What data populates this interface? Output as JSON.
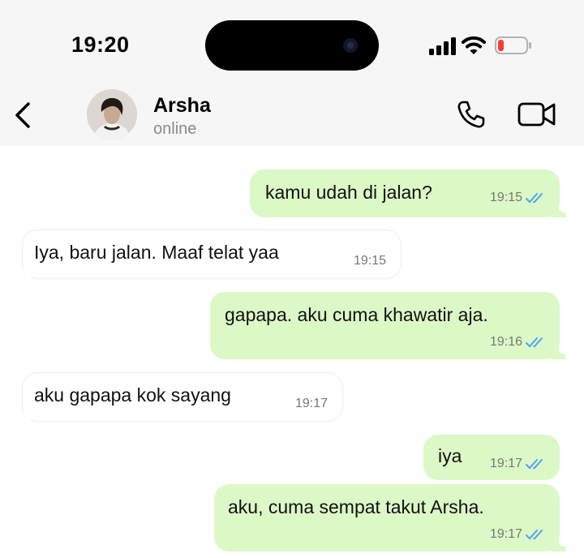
{
  "status_bar": {
    "time": "19:20",
    "icons": [
      "signal-icon",
      "wifi-icon",
      "battery-low-icon"
    ],
    "battery_color": "#ff3b30"
  },
  "header": {
    "contact_name": "Arsha",
    "presence": "online",
    "icons": [
      "back-chevron-icon",
      "avatar",
      "phone-icon",
      "video-call-icon"
    ],
    "accent": "#000000"
  },
  "colors": {
    "outgoing_bubble": "#dcf8c6",
    "incoming_bubble": "#ffffff",
    "read_ticks": "#4fa3f7"
  },
  "messages": [
    {
      "direction": "out",
      "text": "kamu udah di jalan?",
      "time": "19:15",
      "status": "read"
    },
    {
      "direction": "in",
      "text": "Iya, baru jalan. Maaf telat yaa",
      "time": "19:15"
    },
    {
      "direction": "out",
      "text": "gapapa. aku cuma khawatir aja.",
      "time": "19:16",
      "status": "read"
    },
    {
      "direction": "in",
      "text": "aku gapapa kok sayang",
      "time": "19:17"
    },
    {
      "direction": "out",
      "text": "iya",
      "time": "19:17",
      "status": "read"
    },
    {
      "direction": "out",
      "text": "aku, cuma sempat takut Arsha.",
      "time": "19:17",
      "status": "read"
    }
  ]
}
